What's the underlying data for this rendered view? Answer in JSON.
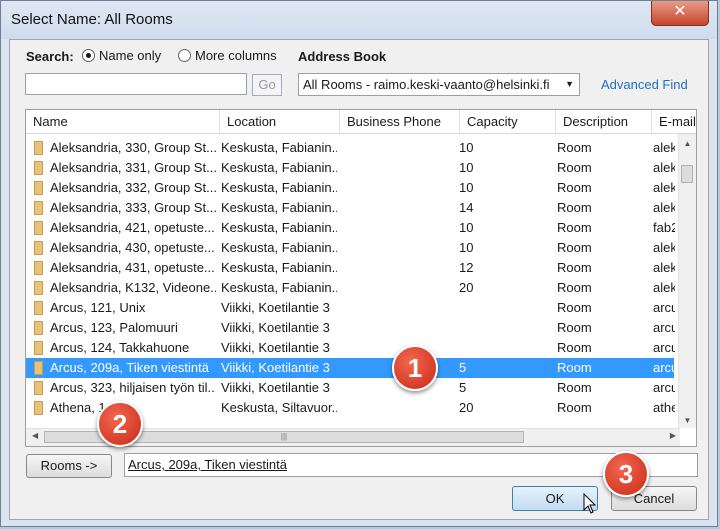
{
  "window": {
    "title": "Select Name: All Rooms",
    "close_glyph": "✕"
  },
  "search": {
    "label": "Search:",
    "options": [
      "Name only",
      "More columns"
    ],
    "selected": "Name only",
    "input_value": "",
    "go_label": "Go"
  },
  "address_book": {
    "label": "Address Book",
    "selected": "All Rooms - raimo.keski-vaanto@helsinki.fi",
    "advanced_find": "Advanced Find"
  },
  "columns": [
    "Name",
    "Location",
    "Business Phone",
    "Capacity",
    "Description",
    "E-mail"
  ],
  "rows": [
    {
      "name": "Aleksandria, 330, Group St...",
      "location": "Keskusta, Fabianin...",
      "phone": "",
      "capacity": "10",
      "description": "Room",
      "email": "alek"
    },
    {
      "name": "Aleksandria, 331, Group St...",
      "location": "Keskusta, Fabianin...",
      "phone": "",
      "capacity": "10",
      "description": "Room",
      "email": "alek"
    },
    {
      "name": "Aleksandria, 332, Group St...",
      "location": "Keskusta, Fabianin...",
      "phone": "",
      "capacity": "10",
      "description": "Room",
      "email": "alek"
    },
    {
      "name": "Aleksandria, 333, Group St...",
      "location": "Keskusta, Fabianin...",
      "phone": "",
      "capacity": "14",
      "description": "Room",
      "email": "alek"
    },
    {
      "name": "Aleksandria, 421, opetuste...",
      "location": "Keskusta, Fabianin...",
      "phone": "",
      "capacity": "10",
      "description": "Room",
      "email": "fab2"
    },
    {
      "name": "Aleksandria, 430, opetuste...",
      "location": "Keskusta, Fabianin...",
      "phone": "",
      "capacity": "10",
      "description": "Room",
      "email": "alek"
    },
    {
      "name": "Aleksandria, 431, opetuste...",
      "location": "Keskusta, Fabianin...",
      "phone": "",
      "capacity": "12",
      "description": "Room",
      "email": "alek"
    },
    {
      "name": "Aleksandria, K132, Videone...",
      "location": "Keskusta, Fabianin...",
      "phone": "",
      "capacity": "20",
      "description": "Room",
      "email": "alek"
    },
    {
      "name": "Arcus, 121, Unix",
      "location": "Viikki, Koetilantie 3",
      "phone": "",
      "capacity": "",
      "description": "Room",
      "email": "arcu"
    },
    {
      "name": "Arcus, 123, Palomuuri",
      "location": "Viikki, Koetilantie 3",
      "phone": "",
      "capacity": "",
      "description": "Room",
      "email": "arcu"
    },
    {
      "name": "Arcus, 124, Takkahuone",
      "location": "Viikki, Koetilantie 3",
      "phone": "",
      "capacity": "",
      "description": "Room",
      "email": "arcu"
    },
    {
      "name": "Arcus, 209a, Tiken viestintä",
      "location": "Viikki, Koetilantie 3",
      "phone": "",
      "capacity": "5",
      "description": "Room",
      "email": "arcu"
    },
    {
      "name": "Arcus, 323, hiljaisen työn til...",
      "location": "Viikki, Koetilantie 3",
      "phone": "",
      "capacity": "5",
      "description": "Room",
      "email": "arcu"
    },
    {
      "name": "Athena, 1",
      "location": "Keskusta, Siltavuor...",
      "phone": "",
      "capacity": "20",
      "description": "Room",
      "email": "athe"
    }
  ],
  "selected_row_index": 11,
  "rooms_button": "Rooms ->",
  "rooms_value": "Arcus, 209a, Tiken viestintä",
  "ok_label": "OK",
  "cancel_label": "Cancel",
  "callouts": [
    "1",
    "2",
    "3"
  ],
  "colors": {
    "selection": "#3399ff",
    "link": "#1f6fc1",
    "callout": "#d8321d"
  }
}
